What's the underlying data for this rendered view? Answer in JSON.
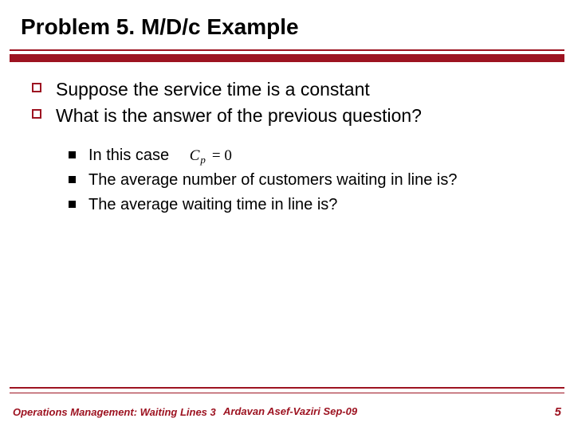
{
  "title": "Problem 5. M/D/c Example",
  "bullets_l1": [
    "Suppose the service time is a constant",
    "What is the answer of the previous question?"
  ],
  "bullets_l2": [
    {
      "text": "In this case",
      "formula": {
        "sym": "C",
        "sub": "p",
        "rhs": "= 0"
      }
    },
    {
      "text": "The average number of customers waiting in line is?"
    },
    {
      "text": "The average waiting time in line is?"
    }
  ],
  "footer": {
    "left": "Operations Management: Waiting Lines 3",
    "center": "Ardavan Asef-Vaziri    Sep-09",
    "page": "5"
  }
}
